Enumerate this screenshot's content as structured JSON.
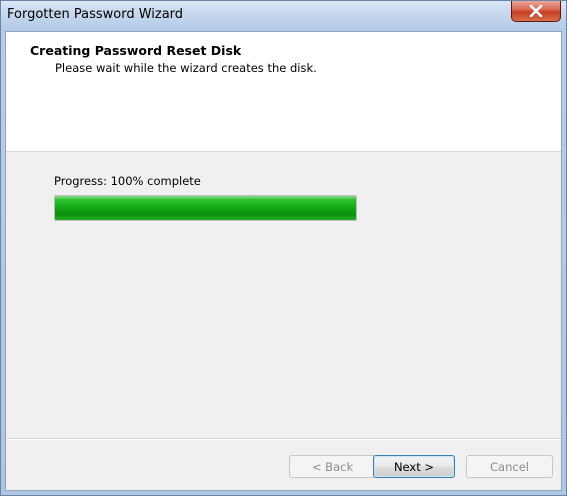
{
  "window": {
    "title": "Forgotten Password Wizard"
  },
  "header": {
    "title": "Creating Password Reset Disk",
    "subtitle": "Please wait while the wizard creates the disk."
  },
  "progress": {
    "label": "Progress: 100% complete",
    "percent": 100,
    "fill_color": "#13a813"
  },
  "buttons": {
    "back_label": "< Back",
    "next_label": "Next >",
    "cancel_label": "Cancel"
  },
  "icons": {
    "close": "close-icon"
  }
}
